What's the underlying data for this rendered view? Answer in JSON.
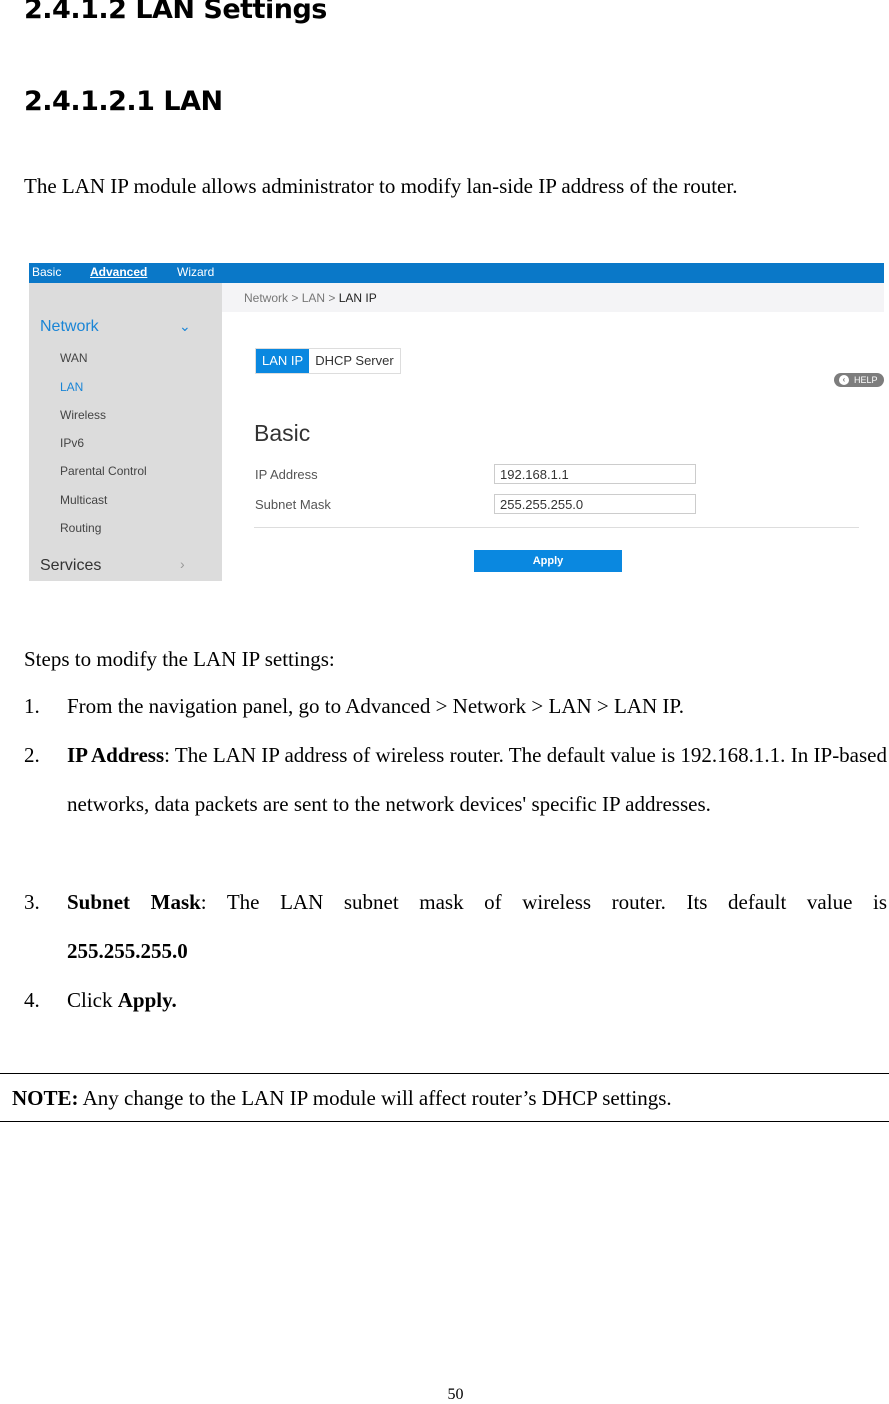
{
  "document": {
    "heading_1": "2.4.1.2 LAN Settings",
    "heading_2": "2.4.1.2.1 LAN",
    "intro": "The LAN IP module allows administrator to modify lan-side IP address of the router.",
    "steps_intro": "Steps to modify the LAN IP settings:",
    "steps": [
      {
        "num": "1.",
        "text": "From the navigation panel, go to Advanced > Network > LAN > LAN IP."
      },
      {
        "num": "2.",
        "bold": "IP Address",
        "text": ": The LAN IP address of wireless router. The default value is 192.168.1.1. In IP-based networks, data packets are sent to the network devices' specific IP addresses."
      },
      {
        "num": "3.",
        "bold": "Subnet Mask",
        "text": ": The LAN subnet mask of wireless router. Its default value is",
        "bold_value": "255.255.255.0"
      },
      {
        "num": "4.",
        "text": "Click ",
        "bold": "Apply."
      }
    ],
    "note_label": "NOTE:",
    "note_text": " Any change to the LAN IP module will affect router’s DHCP settings.",
    "page_number": "50"
  },
  "router_ui": {
    "top_tabs": [
      {
        "label": "Basic",
        "active": false
      },
      {
        "label": "Advanced",
        "active": true
      },
      {
        "label": "Wizard",
        "active": false
      }
    ],
    "sidebar": {
      "groups": [
        {
          "label": "Network",
          "expanded": true,
          "icon": "chevron-down-icon"
        },
        {
          "label": "Services",
          "expanded": false,
          "icon": "chevron-right-icon"
        }
      ],
      "items": [
        {
          "label": "WAN",
          "active": false
        },
        {
          "label": "LAN",
          "active": true
        },
        {
          "label": "Wireless",
          "active": false
        },
        {
          "label": "IPv6",
          "active": false
        },
        {
          "label": "Parental Control",
          "active": false
        },
        {
          "label": "Multicast",
          "active": false
        },
        {
          "label": "Routing",
          "active": false
        }
      ]
    },
    "breadcrumb": {
      "part1": "Network",
      "sep": " > ",
      "part2": "LAN",
      "current": "LAN IP"
    },
    "tabs": [
      {
        "label": "LAN IP",
        "active": true
      },
      {
        "label": "DHCP Server",
        "active": false
      }
    ],
    "help_label": "HELP",
    "section_title": "Basic",
    "fields": [
      {
        "label": "IP Address",
        "value": "192.168.1.1"
      },
      {
        "label": "Subnet Mask",
        "value": "255.255.255.0"
      }
    ],
    "apply_label": "Apply",
    "colors": {
      "topbar": "#0a78c8",
      "accent": "#0a88e0",
      "sidebar_bg": "#dcdcdc",
      "active_link": "#1a85d6"
    }
  }
}
